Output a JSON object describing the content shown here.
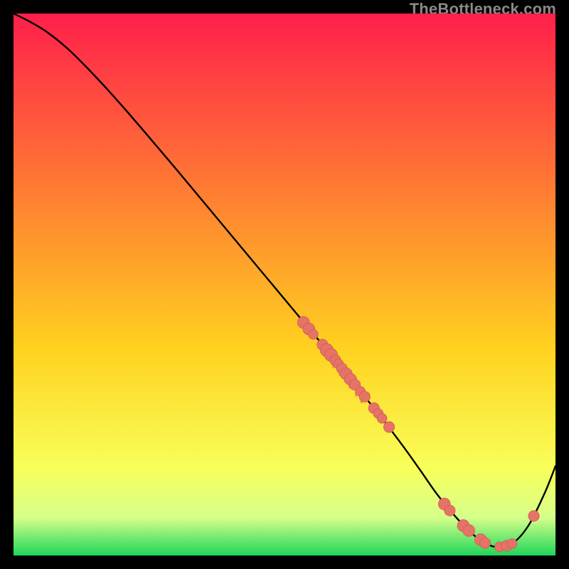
{
  "watermark": "TheBottleneck.com",
  "colors": {
    "gradient_top": "#ff1f4b",
    "gradient_mid_high": "#ff7a33",
    "gradient_mid": "#ffd21f",
    "gradient_low1": "#f8ff5a",
    "gradient_low2": "#d6ff8a",
    "gradient_bottom": "#1fd65a",
    "curve": "#000000",
    "marker_fill": "#e57368",
    "marker_stroke": "#d45a50"
  },
  "chart_data": {
    "type": "line",
    "title": "",
    "xlabel": "",
    "ylabel": "",
    "xlim": [
      0,
      100
    ],
    "ylim": [
      0,
      100
    ],
    "series": [
      {
        "name": "bottleneck-curve",
        "x": [
          0,
          3,
          6,
          10,
          15,
          20,
          25,
          30,
          35,
          40,
          45,
          50,
          55,
          60,
          64,
          68,
          72,
          75,
          78,
          81,
          84,
          86.5,
          89,
          92,
          95,
          98,
          100
        ],
        "y": [
          100,
          98.5,
          96.7,
          93.5,
          88.5,
          83,
          77.2,
          71.3,
          65.3,
          59.3,
          53.3,
          47.3,
          41.3,
          35.3,
          30.3,
          25.3,
          20,
          15.8,
          11.5,
          7.8,
          4.6,
          2.6,
          1.6,
          2.2,
          5.5,
          11.5,
          16.5
        ]
      }
    ],
    "markers": [
      {
        "x": 53.5,
        "y": 43.0,
        "r": 1.1
      },
      {
        "x": 54.5,
        "y": 41.8,
        "r": 1.1
      },
      {
        "x": 55.3,
        "y": 40.8,
        "r": 0.9
      },
      {
        "x": 57.0,
        "y": 38.9,
        "r": 1.0
      },
      {
        "x": 57.8,
        "y": 37.9,
        "r": 1.2
      },
      {
        "x": 58.6,
        "y": 37.0,
        "r": 1.2
      },
      {
        "x": 59.4,
        "y": 36.0,
        "r": 1.0
      },
      {
        "x": 60.0,
        "y": 35.3,
        "r": 0.9
      },
      {
        "x": 60.6,
        "y": 34.5,
        "r": 1.0
      },
      {
        "x": 61.4,
        "y": 33.5,
        "r": 1.1
      },
      {
        "x": 62.2,
        "y": 32.5,
        "r": 1.1
      },
      {
        "x": 63.0,
        "y": 31.5,
        "r": 1.0
      },
      {
        "x": 64.0,
        "y": 30.3,
        "r": 0.9
      },
      {
        "x": 64.8,
        "y": 29.3,
        "r": 1.0
      },
      {
        "x": 66.5,
        "y": 27.2,
        "r": 1.0
      },
      {
        "x": 67.3,
        "y": 26.2,
        "r": 0.9
      },
      {
        "x": 68.0,
        "y": 25.3,
        "r": 0.9
      },
      {
        "x": 69.3,
        "y": 23.7,
        "r": 1.0
      },
      {
        "x": 79.5,
        "y": 9.5,
        "r": 1.1
      },
      {
        "x": 80.5,
        "y": 8.3,
        "r": 1.0
      },
      {
        "x": 83.0,
        "y": 5.5,
        "r": 1.1
      },
      {
        "x": 84.0,
        "y": 4.6,
        "r": 1.1
      },
      {
        "x": 86.2,
        "y": 2.9,
        "r": 1.1
      },
      {
        "x": 87.0,
        "y": 2.3,
        "r": 1.0
      },
      {
        "x": 89.7,
        "y": 1.6,
        "r": 0.9
      },
      {
        "x": 91.0,
        "y": 1.8,
        "r": 1.0
      },
      {
        "x": 92.0,
        "y": 2.2,
        "r": 0.9
      },
      {
        "x": 96.0,
        "y": 7.3,
        "r": 1.0
      }
    ],
    "highlight_tick_markers": [
      {
        "x": 59.0,
        "y": 36.6
      },
      {
        "x": 60.2,
        "y": 35.1
      },
      {
        "x": 61.2,
        "y": 33.9
      },
      {
        "x": 62.0,
        "y": 32.8
      },
      {
        "x": 63.2,
        "y": 31.3
      },
      {
        "x": 64.2,
        "y": 30.1
      }
    ]
  }
}
